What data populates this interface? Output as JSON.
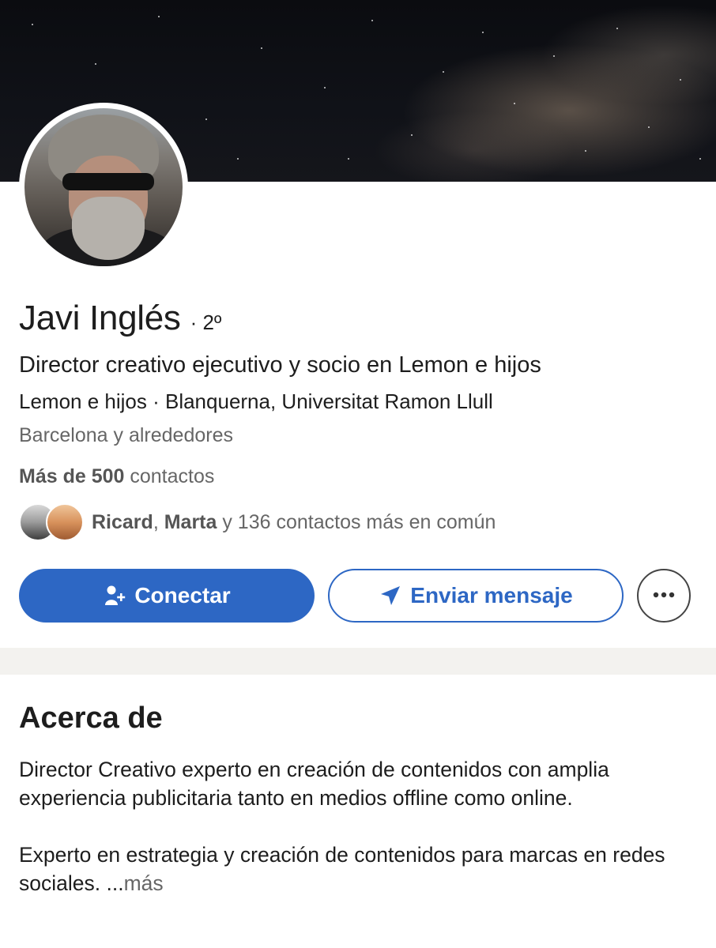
{
  "profile": {
    "name": "Javi Inglés",
    "degree": "· 2º",
    "headline": "Director creativo ejecutivo y socio en Lemon e hijos",
    "companies": "Lemon e hijos · Blanquerna, Universitat Ramon Llull",
    "location": "Barcelona y alrededores",
    "contacts_count": "Más de 500",
    "contacts_label": "contactos"
  },
  "mutual": {
    "name1": "Ricard",
    "separator": ",",
    "name2": "Marta",
    "rest": "y 136 contactos más en común"
  },
  "actions": {
    "connect_label": "Conectar",
    "message_label": "Enviar mensaje",
    "more_icon": "more-icon"
  },
  "about": {
    "title": "Acerca de",
    "paragraph1": "Director Creativo experto en creación de contenidos con amplia experiencia publicitaria tanto en medios offline como online.",
    "paragraph2": "Experto en estrategia y creación de contenidos para marcas en redes sociales. ...",
    "more_label": "más"
  },
  "colors": {
    "primary": "#2d67c4",
    "band": "#f3f2ef",
    "muted_text": "#666666"
  }
}
